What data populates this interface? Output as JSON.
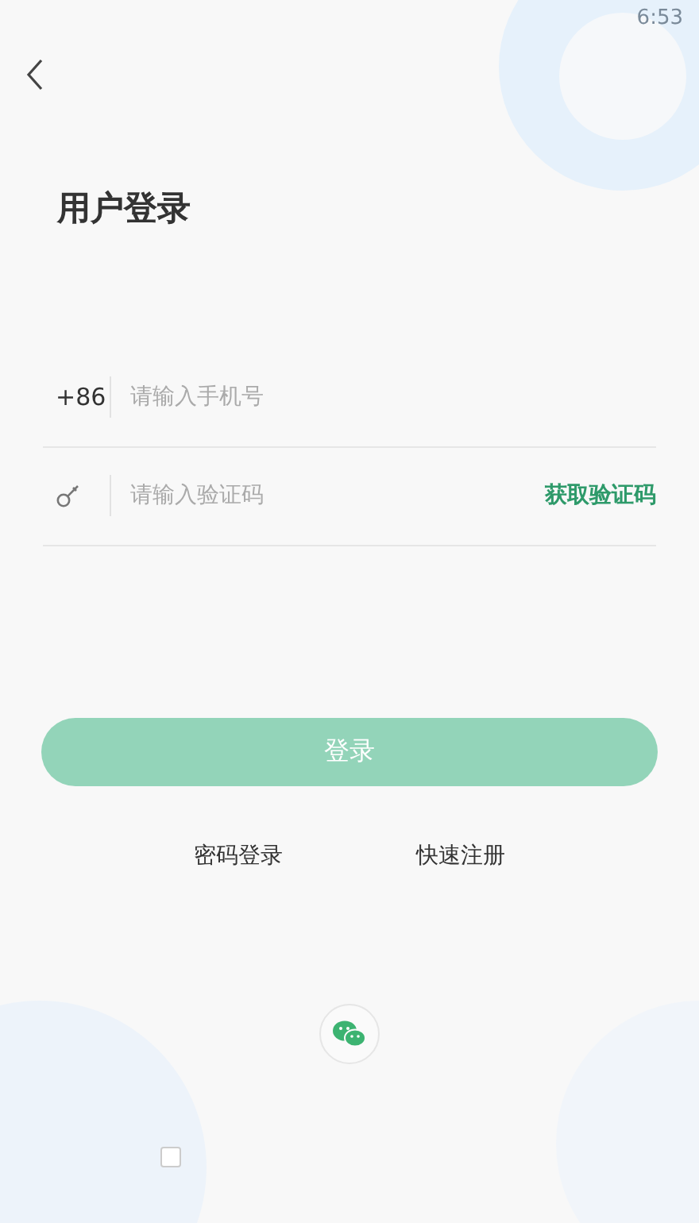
{
  "status_bar": {
    "time": "6:53"
  },
  "title": "用户登录",
  "fields": [
    {
      "kind": "phone",
      "prefix": "+86",
      "placeholder": "请输入手机号"
    },
    {
      "kind": "code",
      "placeholder": "请输入验证码",
      "action": "获取验证码"
    }
  ],
  "login_button": {
    "label": "登录",
    "disabled": true
  },
  "links": [
    "密码登录",
    "快速注册"
  ],
  "agreement": {
    "checked": false
  }
}
